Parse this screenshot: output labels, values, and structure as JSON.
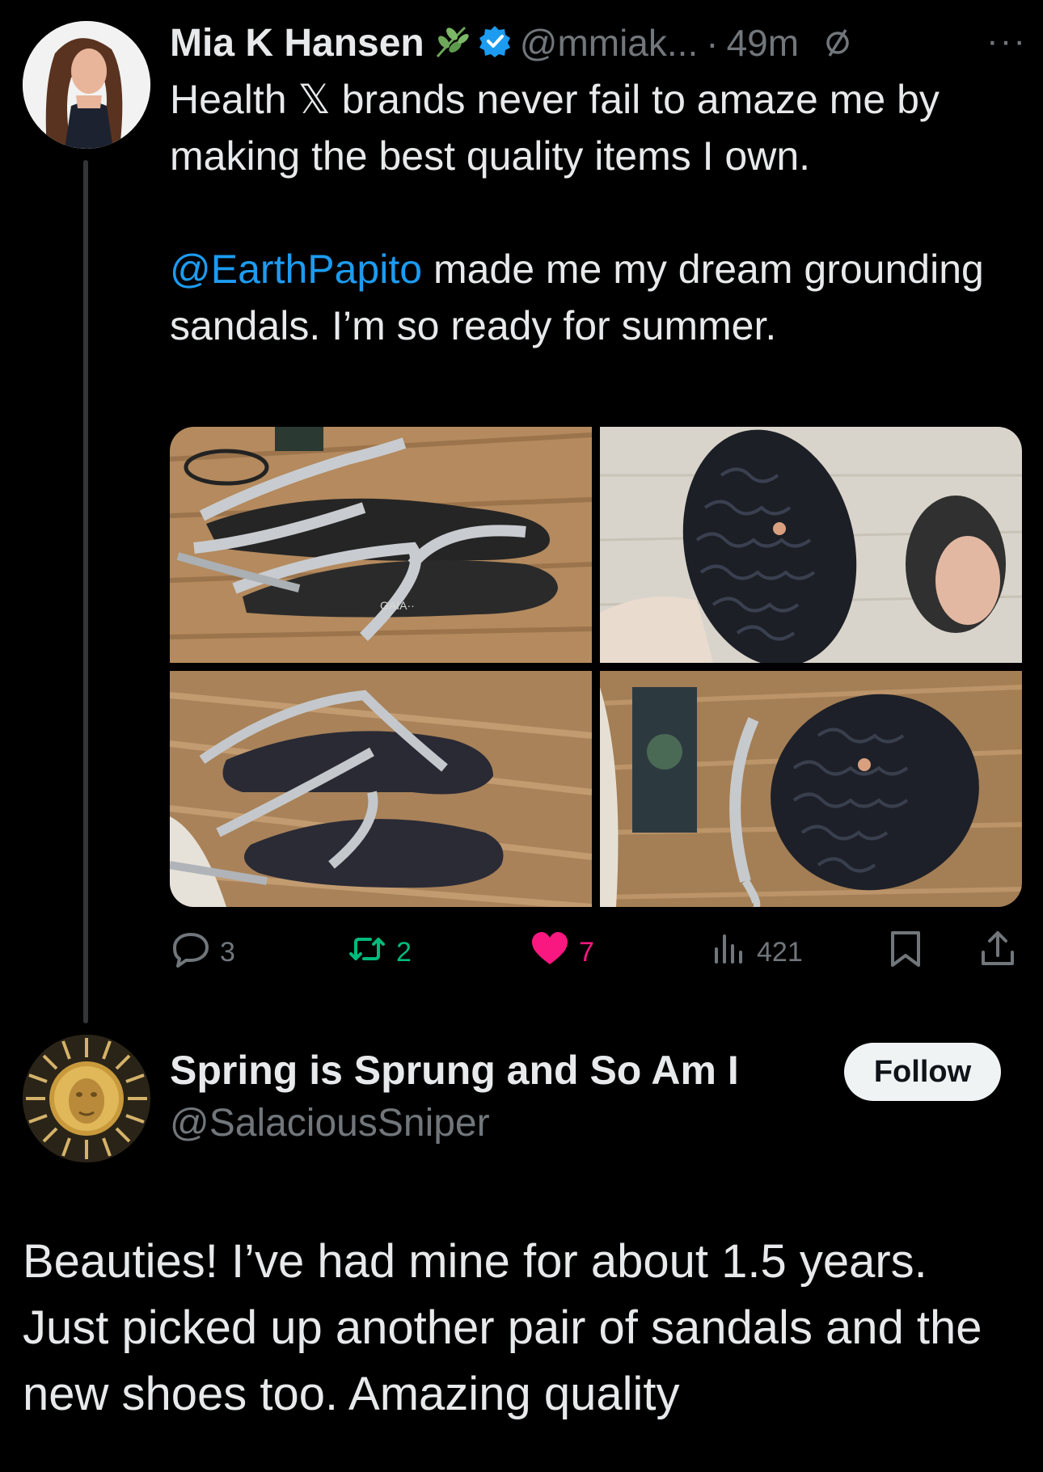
{
  "tweet": {
    "author_name": "Mia K Hansen",
    "handle": "@mmiak...",
    "separator": "·",
    "time": "49m",
    "more": "···",
    "text_line1_a": "Health ",
    "text_line1_x": "𝕏",
    "text_line1_b": " brands never fail to amaze me by making the best quality items I own.",
    "mention": "@EarthPapito",
    "text_para2": " made me my dream grounding sandals. I’m so ready for summer.",
    "sandal_print": "GAIA··",
    "stats": {
      "replies": "3",
      "reposts": "2",
      "likes": "7",
      "views": "421"
    }
  },
  "reply": {
    "author_name": "Spring is Sprung and So Am I",
    "handle": "@SalaciousSniper",
    "follow_label": "Follow",
    "text": "Beauties! I’ve had mine for about 1.5 years. Just picked up another pair of sandals and the new shoes too. Amazing quality"
  },
  "colors": {
    "background": "#000000",
    "text": "#e7e9ea",
    "muted": "#71767b",
    "link": "#1d9bf0",
    "like": "#f91880",
    "repost": "#00ba7c",
    "verified": "#1d9bf0"
  },
  "icons": [
    "leaf-icon",
    "verified-badge-icon",
    "mute-icon",
    "more-icon",
    "reply-icon",
    "repost-icon",
    "like-icon",
    "views-icon",
    "bookmark-icon",
    "share-icon"
  ]
}
